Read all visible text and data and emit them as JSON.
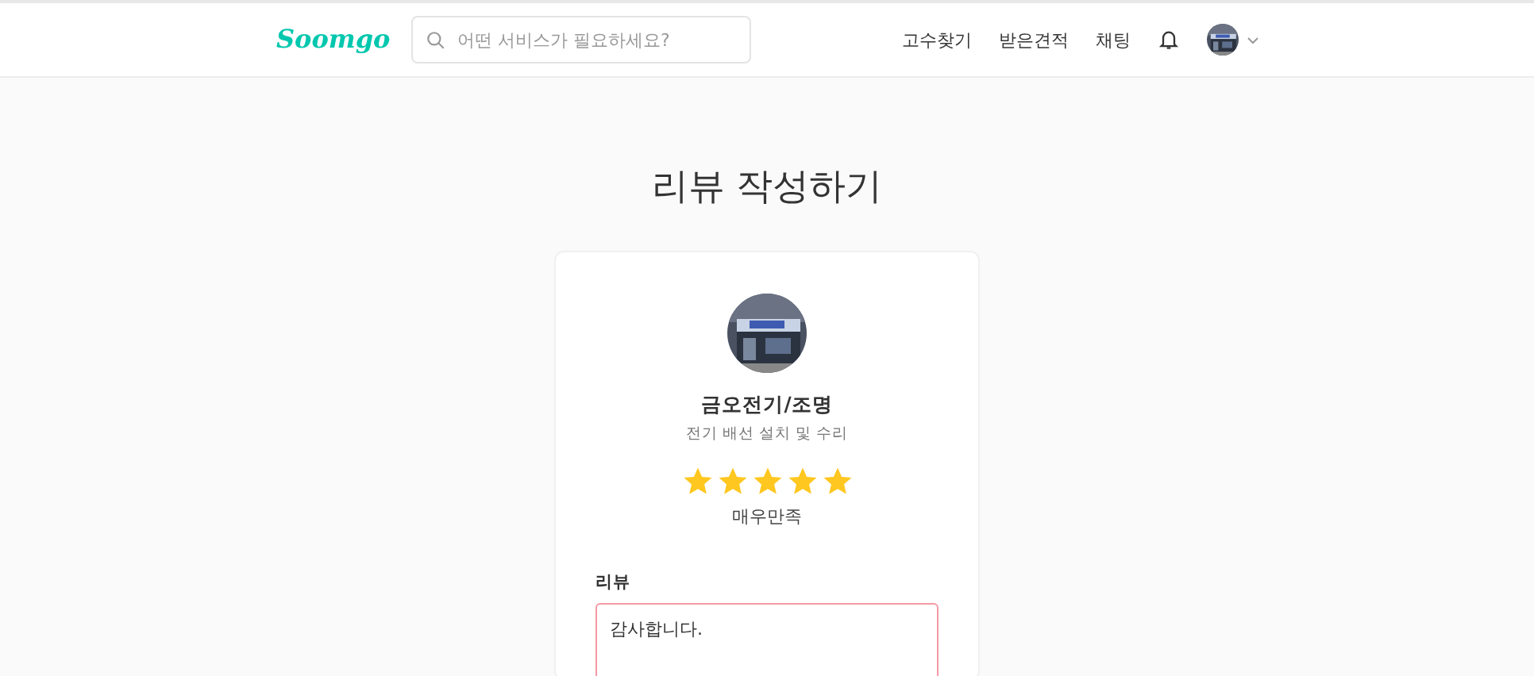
{
  "header": {
    "logo": "Soomgo",
    "search": {
      "placeholder": "어떤 서비스가 필요하세요?"
    },
    "nav": [
      "고수찾기",
      "받은견적",
      "채팅"
    ]
  },
  "page_title": "리뷰 작성하기",
  "provider": {
    "name": "금오전기/조명",
    "service": "전기 배선 설치 및 수리"
  },
  "rating": {
    "stars": 5,
    "label": "매우만족"
  },
  "review": {
    "label": "리뷰",
    "value": "감사합니다.",
    "invalid": true
  }
}
